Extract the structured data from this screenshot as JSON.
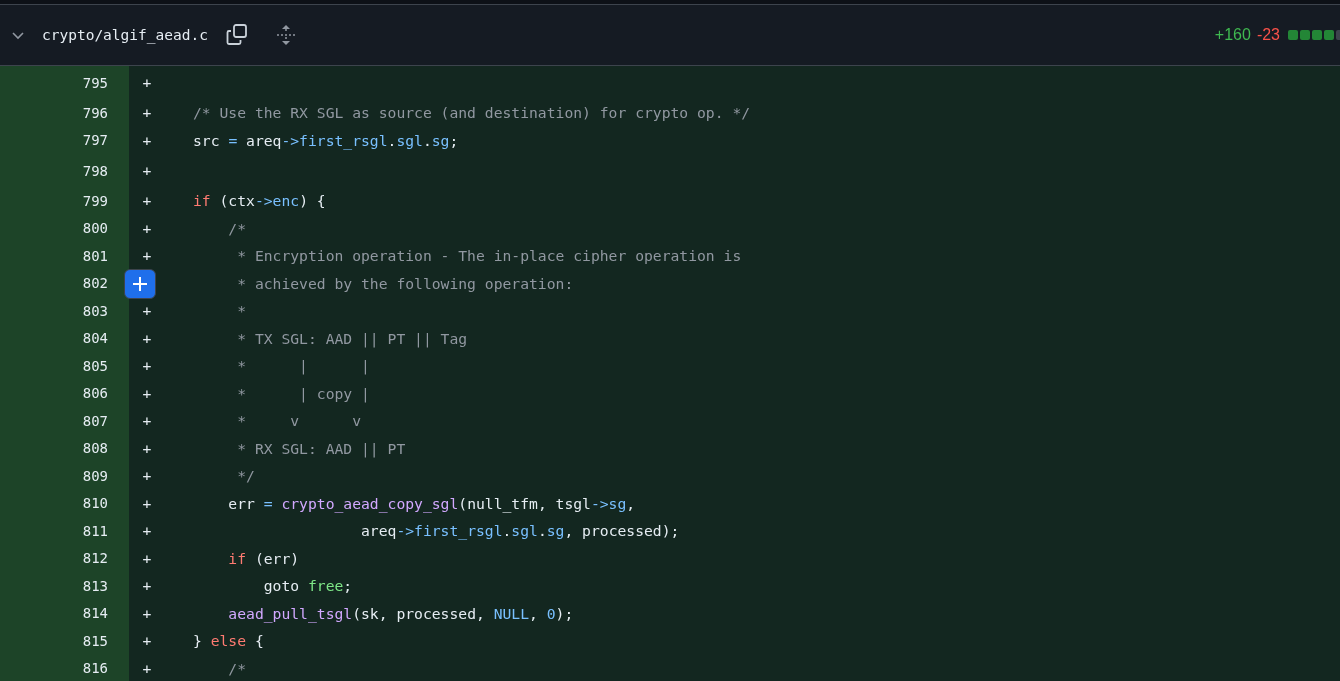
{
  "file_header": {
    "expanded": true,
    "path": "crypto/algif_aead.c",
    "additions": "+160",
    "deletions": "-23",
    "diffstat": [
      {
        "kind": "added"
      },
      {
        "kind": "added"
      },
      {
        "kind": "added"
      },
      {
        "kind": "added"
      },
      {
        "kind": "neutral"
      }
    ]
  },
  "diff_lines": [
    {
      "number": "795",
      "marker": "+",
      "hovered": false
    },
    {
      "number": "796",
      "marker": "+",
      "hovered": false,
      "tokens": [
        {
          "text": "/* Use the RX SGL as source (and destination) for crypto op. */",
          "kind": "comment"
        }
      ]
    },
    {
      "number": "797",
      "marker": "+",
      "hovered": false,
      "tokens": [
        {
          "text": "src ",
          "kind": "plain"
        },
        {
          "text": "=",
          "kind": "constant"
        },
        {
          "text": " areq",
          "kind": "plain"
        },
        {
          "text": "->first_rsgl",
          "kind": "constant"
        },
        {
          "text": ".",
          "kind": "plain"
        },
        {
          "text": "sgl",
          "kind": "constant"
        },
        {
          "text": ".",
          "kind": "plain"
        },
        {
          "text": "sg",
          "kind": "constant"
        },
        {
          "text": ";",
          "kind": "plain"
        }
      ]
    },
    {
      "number": "798",
      "marker": "+",
      "hovered": false
    },
    {
      "number": "799",
      "marker": "+",
      "hovered": false,
      "tokens": [
        {
          "text": "if",
          "kind": "keyword"
        },
        {
          "text": " (ctx",
          "kind": "plain"
        },
        {
          "text": "->enc",
          "kind": "constant"
        },
        {
          "text": ") {",
          "kind": "plain"
        }
      ]
    },
    {
      "number": "800",
      "marker": "+",
      "hovered": false,
      "tokens": [
        {
          "text": "    /*",
          "kind": "comment"
        }
      ]
    },
    {
      "number": "801",
      "marker": "+",
      "hovered": false,
      "tokens": [
        {
          "text": "     * Encryption operation - The in-place cipher operation is",
          "kind": "comment"
        }
      ]
    },
    {
      "number": "802",
      "hovered": true,
      "tokens": [
        {
          "text": "     * achieved by the following operation:",
          "kind": "comment"
        }
      ]
    },
    {
      "number": "803",
      "marker": "+",
      "hovered": false,
      "tokens": [
        {
          "text": "     *",
          "kind": "comment"
        }
      ]
    },
    {
      "number": "804",
      "marker": "+",
      "hovered": false,
      "tokens": [
        {
          "text": "     * TX SGL: AAD || PT || Tag",
          "kind": "comment"
        }
      ]
    },
    {
      "number": "805",
      "marker": "+",
      "hovered": false,
      "tokens": [
        {
          "text": "     *      |      |",
          "kind": "comment"
        }
      ]
    },
    {
      "number": "806",
      "marker": "+",
      "hovered": false,
      "tokens": [
        {
          "text": "     *      | copy |",
          "kind": "comment"
        }
      ]
    },
    {
      "number": "807",
      "marker": "+",
      "hovered": false,
      "tokens": [
        {
          "text": "     *     v      v",
          "kind": "comment"
        }
      ]
    },
    {
      "number": "808",
      "marker": "+",
      "hovered": false,
      "tokens": [
        {
          "text": "     * RX SGL: AAD || PT",
          "kind": "comment"
        }
      ]
    },
    {
      "number": "809",
      "marker": "+",
      "hovered": false,
      "tokens": [
        {
          "text": "     */",
          "kind": "comment"
        }
      ]
    },
    {
      "number": "810",
      "marker": "+",
      "hovered": false,
      "tokens": [
        {
          "text": "    err ",
          "kind": "plain"
        },
        {
          "text": "=",
          "kind": "constant"
        },
        {
          "text": " crypto_aead_copy_sgl",
          "kind": "function"
        },
        {
          "text": "(null_tfm, tsgl",
          "kind": "plain"
        },
        {
          "text": "->sg",
          "kind": "constant"
        },
        {
          "text": ",",
          "kind": "plain"
        }
      ]
    },
    {
      "number": "811",
      "marker": "+",
      "hovered": false,
      "tokens": [
        {
          "text": "                   areq",
          "kind": "plain"
        },
        {
          "text": "->first_rsgl",
          "kind": "constant"
        },
        {
          "text": ".",
          "kind": "plain"
        },
        {
          "text": "sgl",
          "kind": "constant"
        },
        {
          "text": ".",
          "kind": "plain"
        },
        {
          "text": "sg",
          "kind": "constant"
        },
        {
          "text": ", processed);",
          "kind": "plain"
        }
      ]
    },
    {
      "number": "812",
      "marker": "+",
      "hovered": false,
      "tokens": [
        {
          "text": "    if",
          "kind": "keyword"
        },
        {
          "text": " (err)",
          "kind": "plain"
        }
      ]
    },
    {
      "number": "813",
      "marker": "+",
      "hovered": false,
      "tokens": [
        {
          "text": "        goto ",
          "kind": "plain"
        },
        {
          "text": "free",
          "kind": "label"
        },
        {
          "text": ";",
          "kind": "plain"
        }
      ]
    },
    {
      "number": "814",
      "marker": "+",
      "hovered": false,
      "tokens": [
        {
          "text": "    aead_pull_tsgl",
          "kind": "function"
        },
        {
          "text": "(sk, processed, ",
          "kind": "plain"
        },
        {
          "text": "NULL",
          "kind": "constant"
        },
        {
          "text": ", ",
          "kind": "plain"
        },
        {
          "text": "0",
          "kind": "constant"
        },
        {
          "text": ");",
          "kind": "plain"
        }
      ]
    },
    {
      "number": "815",
      "marker": "+",
      "hovered": false,
      "tokens": [
        {
          "text": "} ",
          "kind": "plain"
        },
        {
          "text": "else",
          "kind": "keyword"
        },
        {
          "text": " {",
          "kind": "plain"
        }
      ]
    },
    {
      "number": "816",
      "marker": "+",
      "hovered": false,
      "tokens": [
        {
          "text": "    /*",
          "kind": "comment"
        }
      ]
    }
  ]
}
